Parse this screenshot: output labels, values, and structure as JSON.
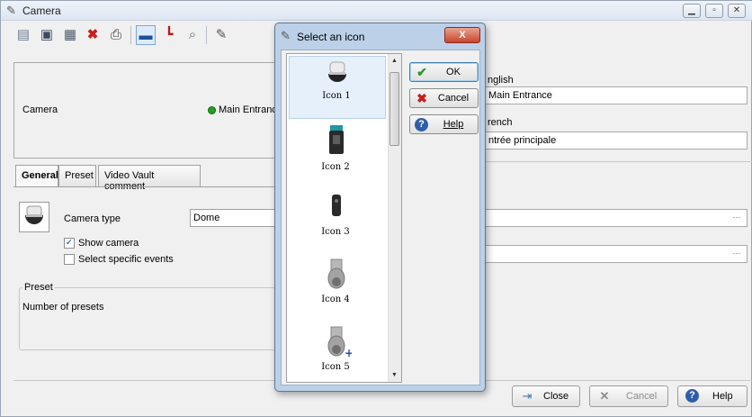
{
  "window": {
    "title": "Camera"
  },
  "header": {
    "camera_label": "Camera",
    "camera_value": "Main Entrance"
  },
  "tabs": [
    {
      "label": "General"
    },
    {
      "label": "Preset"
    },
    {
      "label": "Video Vault comment"
    }
  ],
  "general": {
    "camera_type_label": "Camera type",
    "camera_type_value": "Dome",
    "show_camera_label": "Show camera",
    "show_camera_checked": true,
    "select_events_label": "Select specific events",
    "select_events_checked": false,
    "preset_group_label": "Preset",
    "number_presets_label": "Number of presets"
  },
  "languages": {
    "english_label": "nglish",
    "english_value": "Main Entrance",
    "french_label": "rench",
    "french_value": "ntrée principale"
  },
  "bottom": {
    "close_label": "Close",
    "cancel_label": "Cancel",
    "help_label": "Help"
  },
  "dialog": {
    "title": "Select an icon",
    "close_glyph": "X",
    "icons": [
      {
        "label": "Icon 1",
        "selected": true
      },
      {
        "label": "Icon 2"
      },
      {
        "label": "Icon 3"
      },
      {
        "label": "Icon 4"
      },
      {
        "label": "Icon 5"
      }
    ],
    "ok_label": "OK",
    "cancel_label": "Cancel",
    "help_label": "Help"
  },
  "colors": {
    "accent": "#3c7fb1",
    "ok_check": "#2a9a2a",
    "cancel_x": "#c81e1e",
    "status_green": "#1fa21f"
  }
}
